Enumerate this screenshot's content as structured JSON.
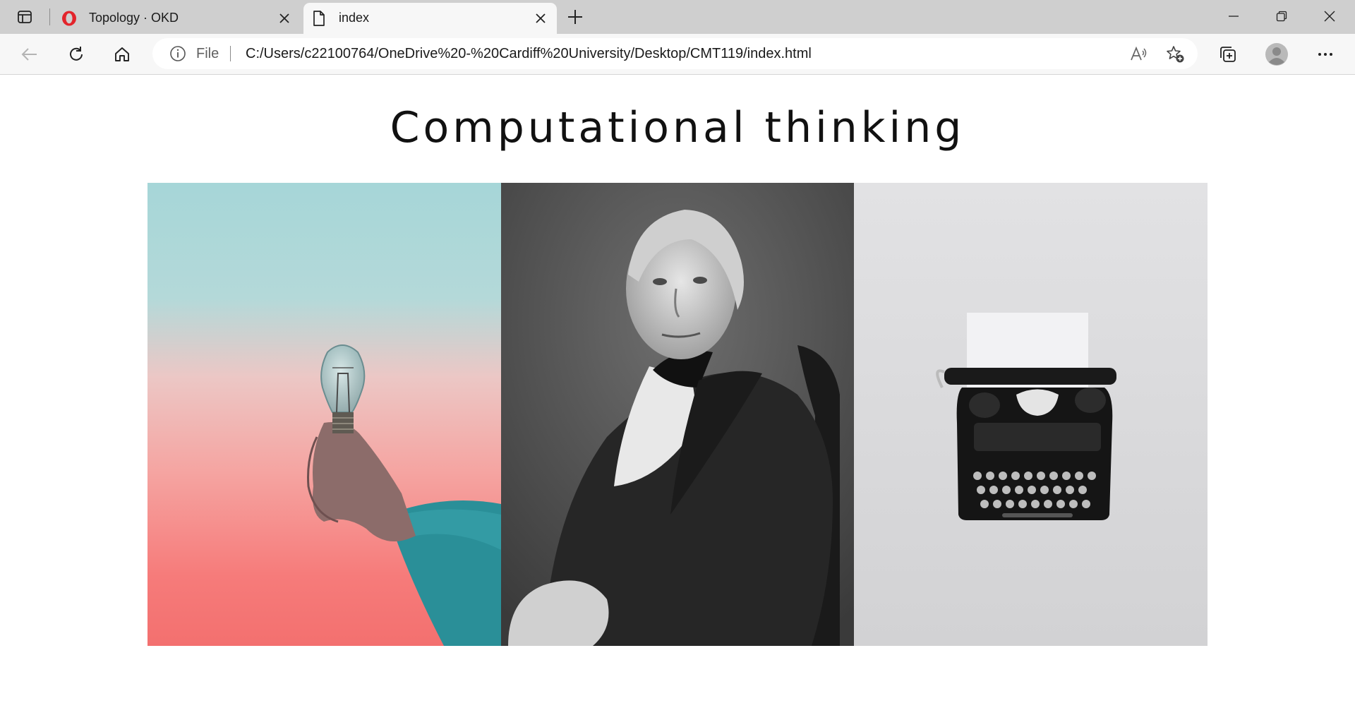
{
  "browser": {
    "tabs": [
      {
        "title": "Topology · OKD",
        "active": false,
        "favicon": "opera-icon"
      },
      {
        "title": "index",
        "active": true,
        "favicon": "page-icon"
      }
    ],
    "address_bar": {
      "scheme_label": "File",
      "url": "C:/Users/c22100764/OneDrive%20-%20Cardiff%20University/Desktop/CMT119/index.html"
    }
  },
  "page": {
    "heading": "Computational thinking",
    "images": [
      {
        "subject": "hand holding light bulb against sky"
      },
      {
        "subject": "black and white portrait of a seated man"
      },
      {
        "subject": "vintage typewriter on white surface"
      }
    ]
  }
}
